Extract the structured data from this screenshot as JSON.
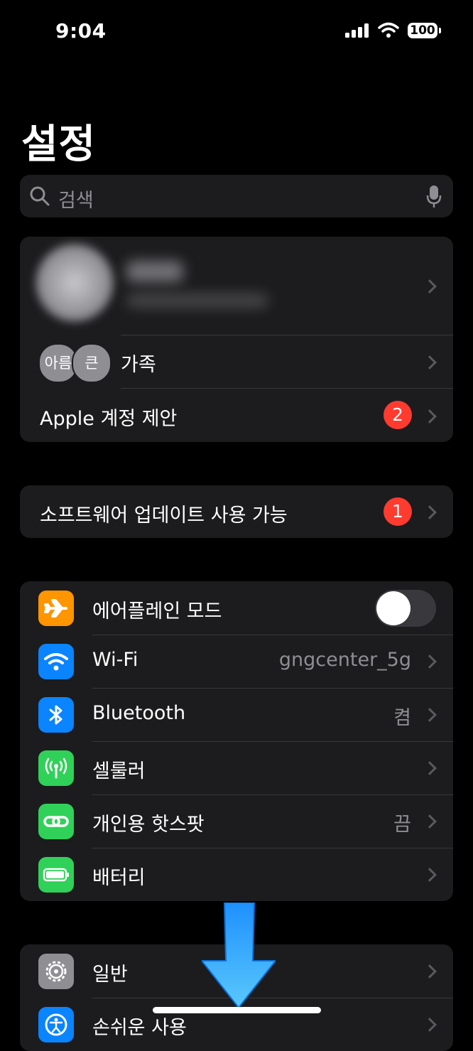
{
  "status_bar": {
    "time": "9:04",
    "battery": "100"
  },
  "title": "설정",
  "search": {
    "placeholder": "검색"
  },
  "account": {
    "family_avatars": [
      "아름",
      "큰"
    ],
    "family_label": "가족",
    "suggestions_label": "Apple 계정 제안",
    "suggestions_badge": "2"
  },
  "update": {
    "label": "소프트웨어 업데이트 사용 가능",
    "badge": "1"
  },
  "connectivity": {
    "airplane": {
      "label": "에어플레인 모드",
      "on": false
    },
    "wifi": {
      "label": "Wi-Fi",
      "value": "gngcenter_5g"
    },
    "bluetooth": {
      "label": "Bluetooth",
      "value": "켬"
    },
    "cellular": {
      "label": "셀룰러"
    },
    "hotspot": {
      "label": "개인용 핫스팟",
      "value": "끔"
    },
    "battery": {
      "label": "배터리"
    }
  },
  "general": {
    "general_label": "일반",
    "accessibility_label": "손쉬운 사용"
  },
  "colors": {
    "airplane": "#ff9500",
    "wifi": "#0a84ff",
    "bluetooth": "#0a84ff",
    "cellular": "#30d158",
    "hotspot": "#30d158",
    "battery": "#30d158",
    "general": "#8e8e93",
    "badge": "#ff3b30"
  },
  "icons": [
    "airplane-icon",
    "wifi-icon",
    "bluetooth-icon",
    "antenna-icon",
    "link-icon",
    "battery-icon",
    "gear-icon",
    "accessibility-icon",
    "search-icon",
    "microphone-icon",
    "down-arrow-icon"
  ]
}
